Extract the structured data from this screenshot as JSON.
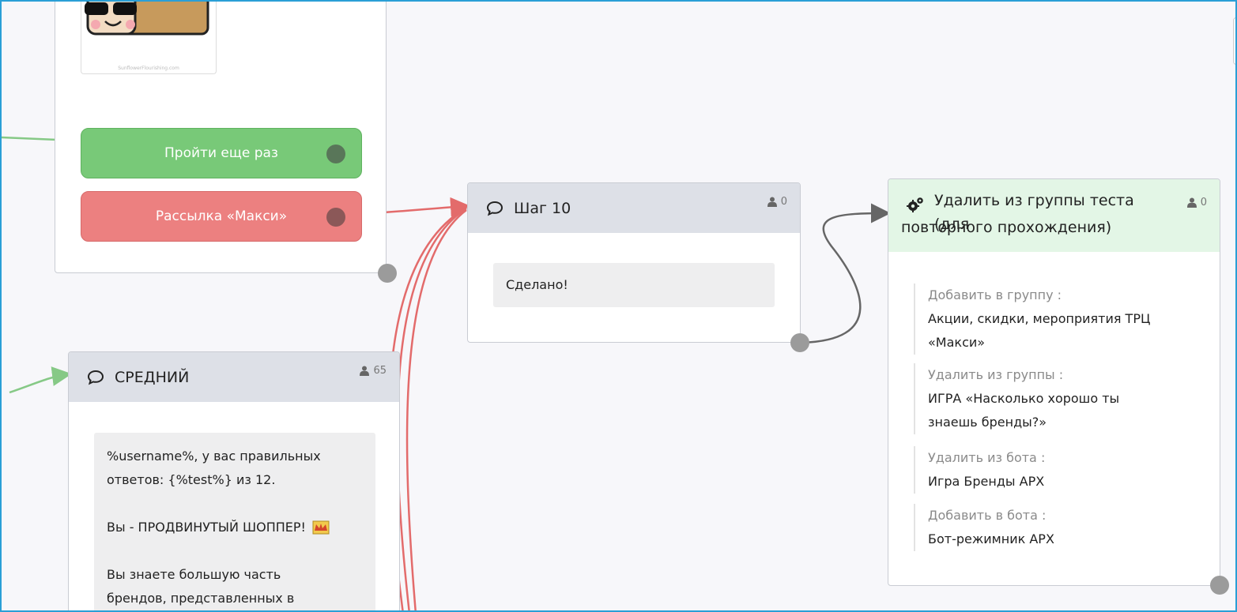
{
  "colors": {
    "canvas_border": "#2a9fd6",
    "canvas_bg": "#f7f7fa",
    "header_gray": "#dde0e7",
    "header_green": "#e3f6e6",
    "button_green": "#78c978",
    "button_red": "#ec8080",
    "link_red": "#e36b6b",
    "link_green": "#86c986",
    "link_gray": "#666666"
  },
  "node_top": {
    "image_icon": "cartoon-box-face-image",
    "image_caption": "SunflowerFlourishing.com",
    "buttons": [
      {
        "label": "Пройти еще раз",
        "color": "green"
      },
      {
        "label": "Рассылка «Макси»",
        "color": "red"
      }
    ]
  },
  "node_step10": {
    "icon": "speech-bubble-icon",
    "title": "Шаг 10",
    "count": "0",
    "message": "Сделано!"
  },
  "node_medium": {
    "icon": "speech-bubble-icon",
    "title": "СРЕДНИЙ",
    "count": "65",
    "message_lines": [
      "%username%, у вас правильных",
      "ответов: {%test%} из 12.",
      "",
      "Вы - ПРОДВИНУТЫЙ ШОППЕР!",
      "",
      "Вы знаете большую часть",
      "брендов, представленных в"
    ],
    "emoji": "crown-emoji"
  },
  "node_action": {
    "icon": "gears-icon",
    "title_line1": "Удалить из группы теста (для",
    "title_line2": "повторного прохождения)",
    "count": "0",
    "actions": [
      {
        "label": "Добавить в группу :",
        "value_line1": "Акции, скидки, мероприятия ТРЦ",
        "value_line2": "«Макси»"
      },
      {
        "label": "Удалить из группы :",
        "value_line1": "ИГРА «Насколько хорошо ты",
        "value_line2": "знаешь бренды?»"
      },
      {
        "label": "Удалить из бота :",
        "value_line1": "Игра Бренды АРХ",
        "value_line2": ""
      },
      {
        "label": "Добавить в бота :",
        "value_line1": "Бот-режимник АРХ",
        "value_line2": ""
      }
    ]
  }
}
